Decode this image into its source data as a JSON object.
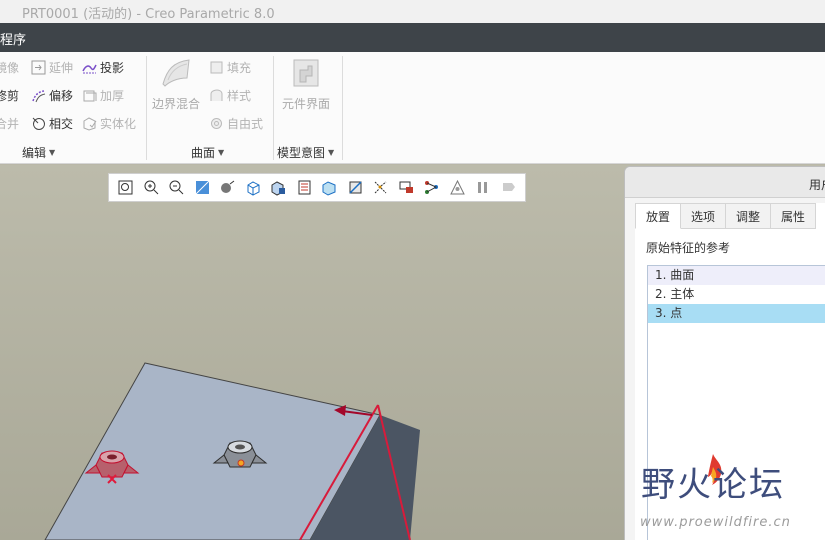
{
  "window": {
    "title": "PRT0001 (活动的) - Creo Parametric 8.0"
  },
  "appbar": {
    "label": "程序"
  },
  "ribbon": {
    "edit": {
      "items": [
        {
          "label": "镜像",
          "icon": "mirror-icon"
        },
        {
          "label": "延伸",
          "icon": "extend-icon"
        },
        {
          "label": "投影",
          "icon": "project-icon"
        },
        {
          "label": "修剪",
          "icon": "trim-icon"
        },
        {
          "label": "偏移",
          "icon": "offset-icon"
        },
        {
          "label": "加厚",
          "icon": "thicken-icon"
        },
        {
          "label": "合并",
          "icon": "merge-icon"
        },
        {
          "label": "相交",
          "icon": "intersect-icon"
        },
        {
          "label": "实体化",
          "icon": "solidify-icon"
        }
      ],
      "group_label": "编辑"
    },
    "surface": {
      "big": {
        "label": "边界混合",
        "icon": "boundary-blend-icon"
      },
      "items": [
        {
          "label": "填充",
          "icon": "fill-icon"
        },
        {
          "label": "样式",
          "icon": "style-icon"
        },
        {
          "label": "自由式",
          "icon": "freestyle-icon"
        }
      ],
      "group_label": "曲面"
    },
    "model_intent": {
      "big": {
        "label": "元件界面",
        "icon": "component-interface-icon"
      },
      "group_label": "模型意图"
    }
  },
  "view_toolbar": {
    "icons": [
      "refit-icon",
      "zoom-in-icon",
      "zoom-out-icon",
      "repaint-icon",
      "display-style-icon",
      "saved-orientations-icon",
      "view-manager-icon",
      "perspective-icon",
      "section-icon",
      "annotation-display-icon",
      "datum-display-icon",
      "spin-center-icon",
      "appearance-icon",
      "pause-icon",
      "view-normal-icon"
    ]
  },
  "dialog": {
    "title": "用户",
    "tabs": [
      "放置",
      "选项",
      "调整",
      "属性"
    ],
    "ref_label": "原始特征的参考",
    "references": [
      "1. 曲面",
      "2. 主体",
      "3. 点"
    ],
    "selected_index": 2
  },
  "watermark": {
    "text": "野火论坛",
    "url": "www.proewildfire.cn"
  },
  "colors": {
    "accent": "#d81b3b",
    "selection": "#a8ddf4",
    "appbar": "#3e4449"
  }
}
